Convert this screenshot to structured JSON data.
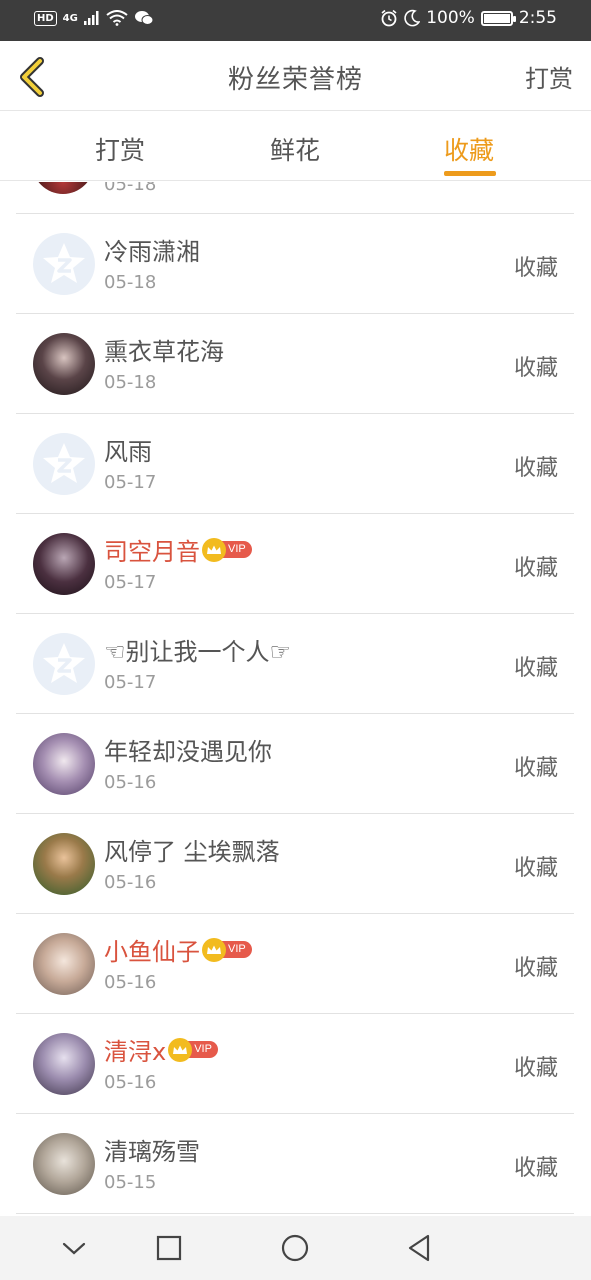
{
  "status_bar": {
    "hd": "HD",
    "network": "4G",
    "icons": [
      "signal-icon",
      "wifi-icon",
      "wechat-icon",
      "alarm-icon",
      "moon-icon",
      "battery-icon"
    ],
    "battery": "100%",
    "battery_level": 1.0,
    "time": "2:55"
  },
  "header": {
    "back_icon": "chevron-left-icon",
    "title": "粉丝荣誉榜",
    "action": "打赏"
  },
  "tabs": {
    "items": [
      "打赏",
      "鲜花",
      "收藏"
    ],
    "active_index": 2,
    "accent_color": "#ed9b1c"
  },
  "list": {
    "partial_item": {
      "date": "05-18"
    },
    "items": [
      {
        "name": "冷雨潇湘",
        "date": "05-18",
        "action": "收藏",
        "vip": false,
        "avatar": "default-avatar-icon"
      },
      {
        "name": "熏衣草花海",
        "date": "05-18",
        "action": "收藏",
        "vip": false,
        "avatar": "user-photo"
      },
      {
        "name": "风雨",
        "date": "05-17",
        "action": "收藏",
        "vip": false,
        "avatar": "default-avatar-icon"
      },
      {
        "name": "司空月音",
        "date": "05-17",
        "action": "收藏",
        "vip": true,
        "vip_label": "VIP",
        "avatar": "user-photo"
      },
      {
        "name": "☜别让我一个人☞",
        "date": "05-17",
        "action": "收藏",
        "vip": false,
        "avatar": "default-avatar-icon"
      },
      {
        "name": "年轻却没遇见你",
        "date": "05-16",
        "action": "收藏",
        "vip": false,
        "avatar": "user-photo"
      },
      {
        "name": "风停了 尘埃飘落",
        "date": "05-16",
        "action": "收藏",
        "vip": false,
        "avatar": "user-photo"
      },
      {
        "name": "小鱼仙子",
        "date": "05-16",
        "action": "收藏",
        "vip": true,
        "vip_label": "VIP",
        "avatar": "user-photo"
      },
      {
        "name": "清浔x",
        "date": "05-16",
        "action": "收藏",
        "vip": true,
        "vip_label": "VIP",
        "avatar": "user-photo"
      },
      {
        "name": "清璃殇雪",
        "date": "05-15",
        "action": "收藏",
        "vip": false,
        "avatar": "user-photo"
      }
    ],
    "vip_name_color": "#d9533e"
  },
  "nav_bar": {
    "buttons": [
      "nav-down-icon",
      "recents-icon",
      "home-icon",
      "back-icon"
    ]
  }
}
